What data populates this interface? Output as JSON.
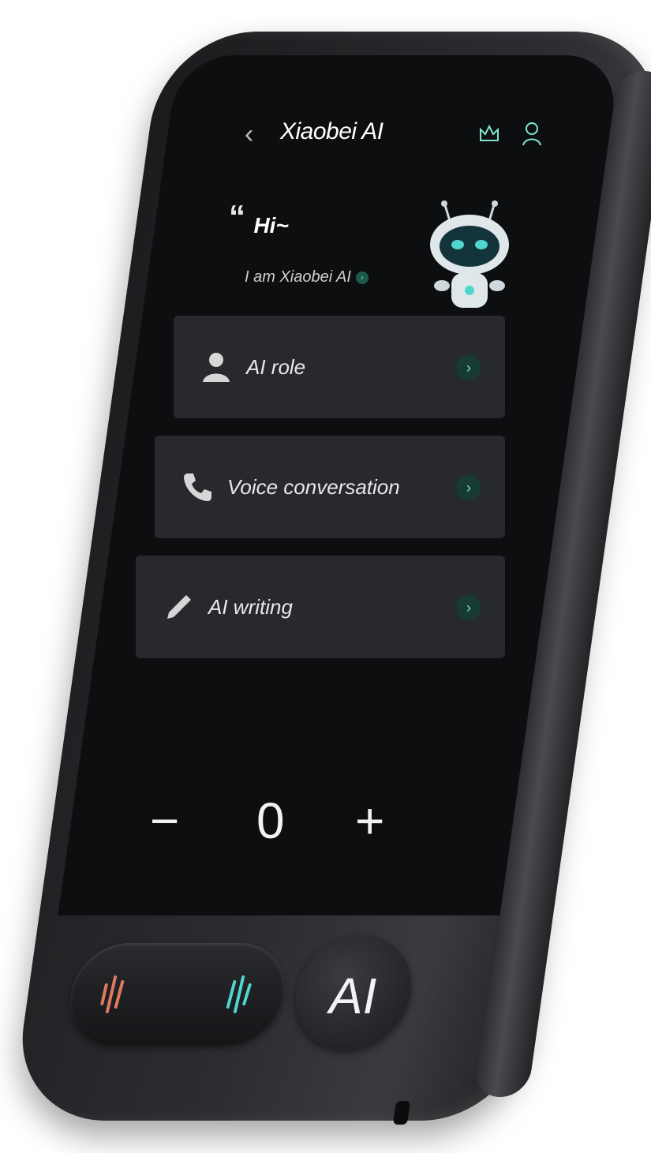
{
  "header": {
    "title": "Xiaobei AI"
  },
  "greeting": {
    "quote": "“",
    "hi": "Hi~",
    "intro": "I am Xiaobei AI"
  },
  "menu": [
    {
      "label": "AI role",
      "icon": "person-icon"
    },
    {
      "label": "Voice conversation",
      "icon": "phone-icon"
    },
    {
      "label": "AI writing",
      "icon": "pen-icon"
    }
  ],
  "controls": {
    "minus": "−",
    "zero": "0",
    "plus": "+"
  },
  "buttons": {
    "ai": "AI"
  },
  "colors": {
    "accent": "#7fe6cf",
    "left_bars": "#e07a5f",
    "right_bars": "#4fd6cf",
    "card": "#28292c",
    "screen": "#0d0e10"
  }
}
